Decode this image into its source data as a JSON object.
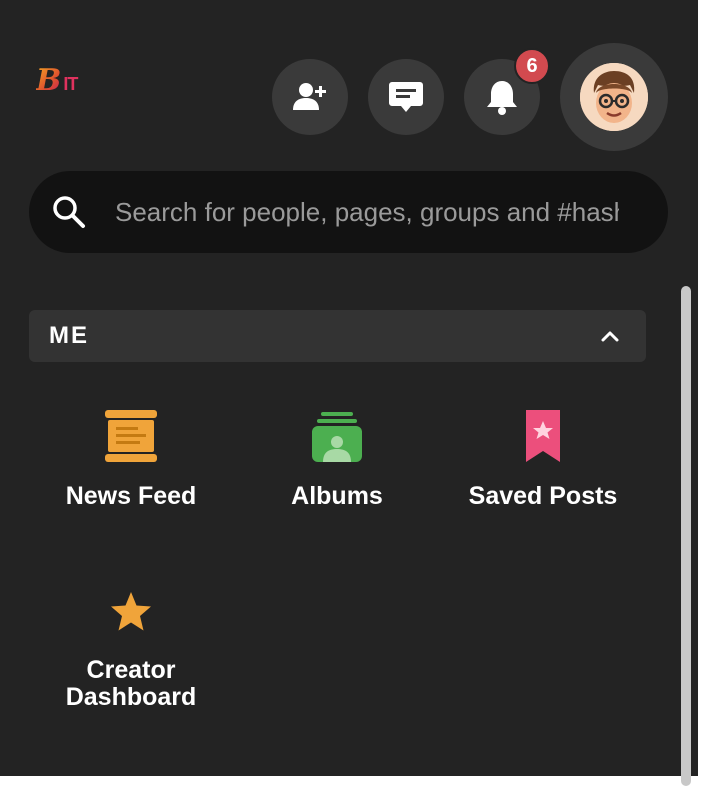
{
  "header": {
    "logo": {
      "mark": "B",
      "text": "IT"
    },
    "notifications": {
      "count": "6"
    },
    "icons": {
      "add_friend": "add-user-icon",
      "messages": "chat-message-icon",
      "notifications": "bell-icon",
      "avatar": "user-avatar"
    }
  },
  "search": {
    "placeholder": "Search for people, pages, groups and #hashtags"
  },
  "section": {
    "title": "ME",
    "collapse_icon": "chevron-up-icon"
  },
  "items": [
    {
      "label": "News Feed",
      "icon": "news-feed-icon",
      "color": "#f0a43a"
    },
    {
      "label": "Albums",
      "icon": "albums-icon",
      "color": "#4caf50"
    },
    {
      "label": "Saved Posts",
      "icon": "bookmark-star-icon",
      "color": "#ec4f7c"
    },
    {
      "label": "Creator Dashboard",
      "icon": "star-icon",
      "color": "#f0a43a"
    }
  ],
  "colors": {
    "background": "#232323",
    "button": "#3a3a3a",
    "badge": "#d24a4f",
    "search_bg": "#121212"
  }
}
